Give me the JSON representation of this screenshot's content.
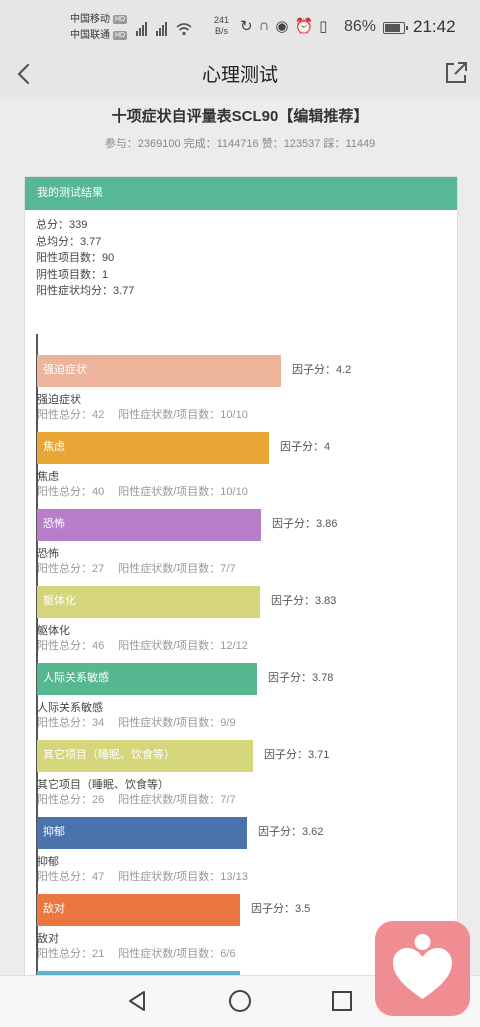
{
  "status_bar": {
    "carrier1": "中国移动",
    "carrier2": "中国联通",
    "hd_badge": "HD",
    "net_speed_value": "241",
    "net_speed_unit": "B/s",
    "battery": "86%",
    "battery_level": 0.86,
    "time": "21:42"
  },
  "nav": {
    "title": "心理测试"
  },
  "page": {
    "title": "十项症状自评量表SCL90【编辑推荐】",
    "stats": "参与：2369100 完成：1144716 赞：123537 踩：11449"
  },
  "result": {
    "header": "我的测试结果",
    "summary": [
      "总分：339",
      "总均分：3.77",
      "阳性项目数：90",
      "阴性项目数：1",
      "阳性症状均分：3.77"
    ]
  },
  "factors": [
    {
      "name": "强迫症状",
      "score": 4.2,
      "score_text": "因子分：4.2",
      "positive_total": "阳性总分：42",
      "ratio": "阳性症状数/项目数：10/10",
      "color": "#edb49c"
    },
    {
      "name": "焦虑",
      "score": 4,
      "score_text": "因子分：4",
      "positive_total": "阳性总分：40",
      "ratio": "阳性症状数/项目数：10/10",
      "color": "#e8a735"
    },
    {
      "name": "恐怖",
      "score": 3.86,
      "score_text": "因子分：3.86",
      "positive_total": "阳性总分：27",
      "ratio": "阳性症状数/项目数：7/7",
      "color": "#b87ec9"
    },
    {
      "name": "躯体化",
      "score": 3.83,
      "score_text": "因子分：3.83",
      "positive_total": "阳性总分：46",
      "ratio": "阳性症状数/项目数：12/12",
      "color": "#d5d57c"
    },
    {
      "name": "人际关系敏感",
      "score": 3.78,
      "score_text": "因子分：3.78",
      "positive_total": "阳性总分：34",
      "ratio": "阳性症状数/项目数：9/9",
      "color": "#58b791"
    },
    {
      "name": "其它项目（睡眠、饮食等）",
      "score": 3.71,
      "score_text": "因子分：3.71",
      "positive_total": "阳性总分：26",
      "ratio": "阳性症状数/项目数：7/7",
      "color": "#d5d57c"
    },
    {
      "name": "抑郁",
      "score": 3.62,
      "score_text": "因子分：3.62",
      "positive_total": "阳性总分：47",
      "ratio": "阳性症状数/项目数：13/13",
      "color": "#4a73ad"
    },
    {
      "name": "敌对",
      "score": 3.5,
      "score_text": "因子分：3.5",
      "positive_total": "阳性总分：21",
      "ratio": "阳性症状数/项目数：6/6",
      "color": "#ec7640"
    },
    {
      "name": "",
      "score": 3.5,
      "score_text": "",
      "positive_total": "",
      "ratio": "",
      "color": "#5fb4d6"
    }
  ],
  "icons": {
    "back": "back-arrow-icon",
    "share": "share-external-icon",
    "nav_back": "triangle-back-icon",
    "nav_home": "circle-home-icon",
    "nav_recent": "square-recent-icon",
    "fab": "heart-person-icon"
  }
}
